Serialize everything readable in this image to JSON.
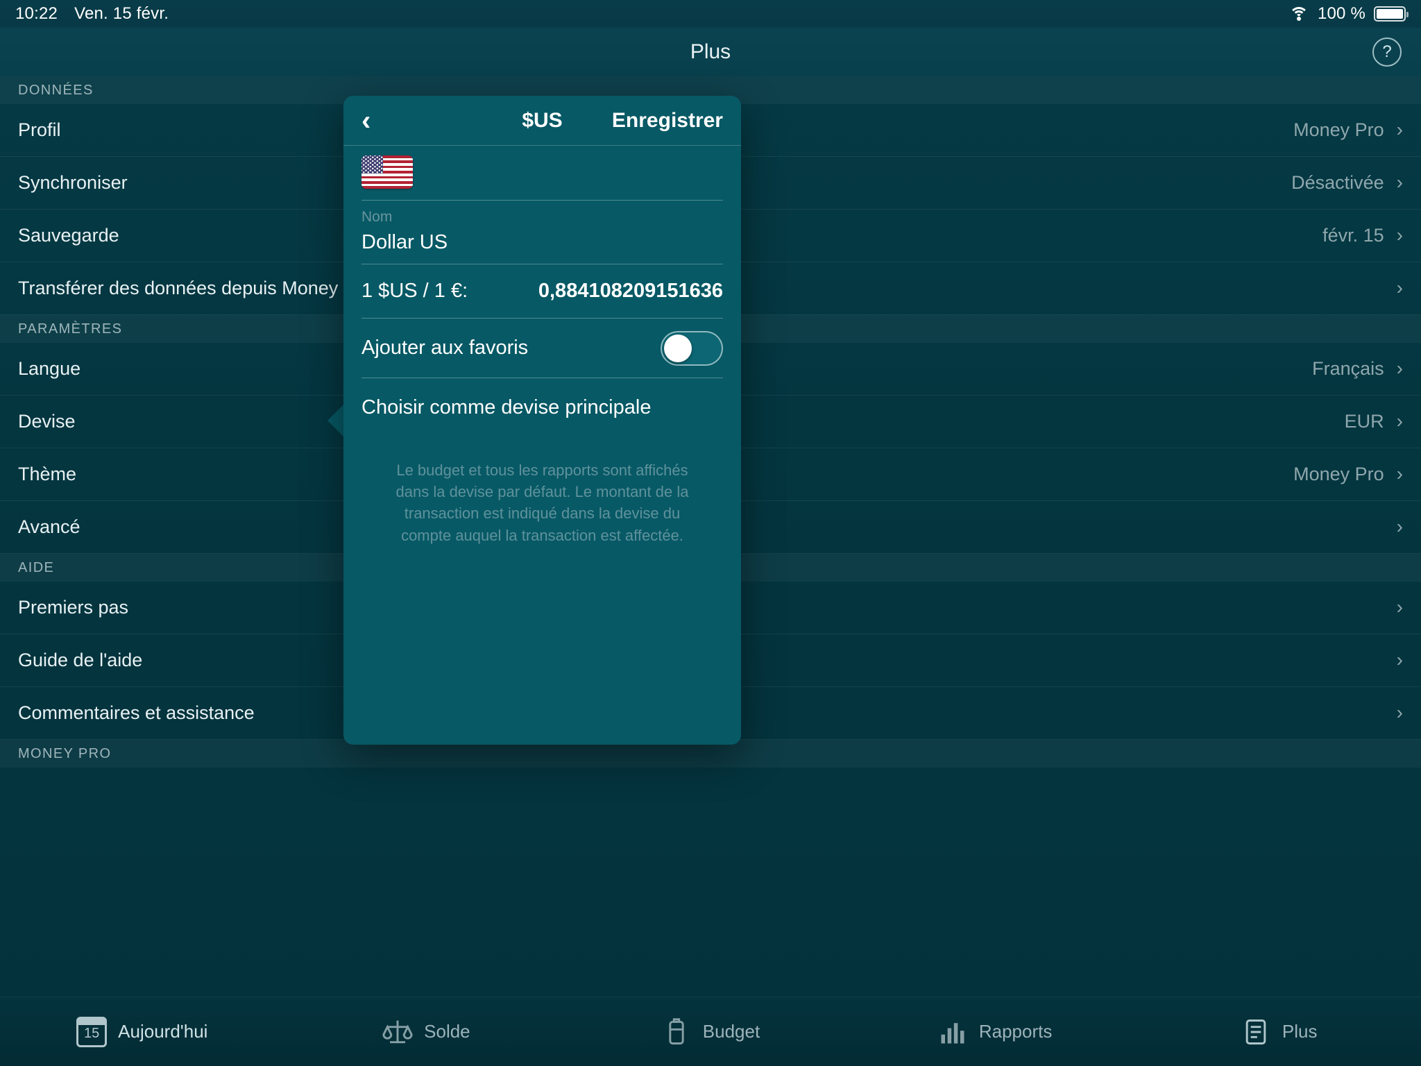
{
  "statusbar": {
    "time": "10:22",
    "date": "Ven. 15 févr.",
    "battery_percent": "100 %",
    "wifi_icon": "wifi-icon",
    "battery_icon": "battery-full-icon"
  },
  "navbar": {
    "title": "Plus",
    "help_label": "?"
  },
  "sections": [
    {
      "header": "DONNÉES",
      "rows": [
        {
          "label": "Profil",
          "value": "Money Pro",
          "chevron": "›"
        },
        {
          "label": "Synchroniser",
          "value": "Désactivée",
          "chevron": "›"
        },
        {
          "label": "Sauvegarde",
          "value": "févr. 15",
          "chevron": "›"
        },
        {
          "label": "Transférer des données depuis Money",
          "value": "",
          "chevron": "›"
        }
      ]
    },
    {
      "header": "PARAMÈTRES",
      "rows": [
        {
          "label": "Langue",
          "value": "Français",
          "chevron": "›"
        },
        {
          "label": "Devise",
          "value": "EUR",
          "chevron": "›"
        },
        {
          "label": "Thème",
          "value": "Money Pro",
          "chevron": "›"
        },
        {
          "label": "Avancé",
          "value": "",
          "chevron": "›"
        }
      ]
    },
    {
      "header": "AIDE",
      "rows": [
        {
          "label": "Premiers pas",
          "value": "",
          "chevron": "›"
        },
        {
          "label": "Guide de l'aide",
          "value": "",
          "chevron": "›"
        },
        {
          "label": "Commentaires et assistance",
          "value": "",
          "chevron": "›"
        }
      ]
    },
    {
      "header": "MONEY PRO",
      "rows": []
    }
  ],
  "tabbar": {
    "items": [
      {
        "label": "Aujourd'hui",
        "icon": "calendar-icon",
        "day": "15"
      },
      {
        "label": "Solde",
        "icon": "scales-icon"
      },
      {
        "label": "Budget",
        "icon": "wallet-icon"
      },
      {
        "label": "Rapports",
        "icon": "bar-chart-icon"
      },
      {
        "label": "Plus",
        "icon": "document-icon"
      }
    ]
  },
  "popover": {
    "back_icon": "chevron-left-icon",
    "title": "$US",
    "save_label": "Enregistrer",
    "flag_icon": "flag-us-icon",
    "name_label": "Nom",
    "name_value": "Dollar US",
    "rate_label": "1 $US / 1 €:",
    "rate_value": "0,884108209151636",
    "favorite_label": "Ajouter aux favoris",
    "favorite_on": false,
    "main_currency_label": "Choisir comme devise principale",
    "note": "Le budget et tous les rapports sont affichés dans la devise par défaut. Le montant de la transaction est indiqué dans la devise du compte auquel la transaction est affectée."
  },
  "colors": {
    "background": "#043540",
    "popover": "#075965",
    "navbar": "#0a4250",
    "muted_text": "#8fa7ad",
    "accent_text": "#ffffff"
  }
}
